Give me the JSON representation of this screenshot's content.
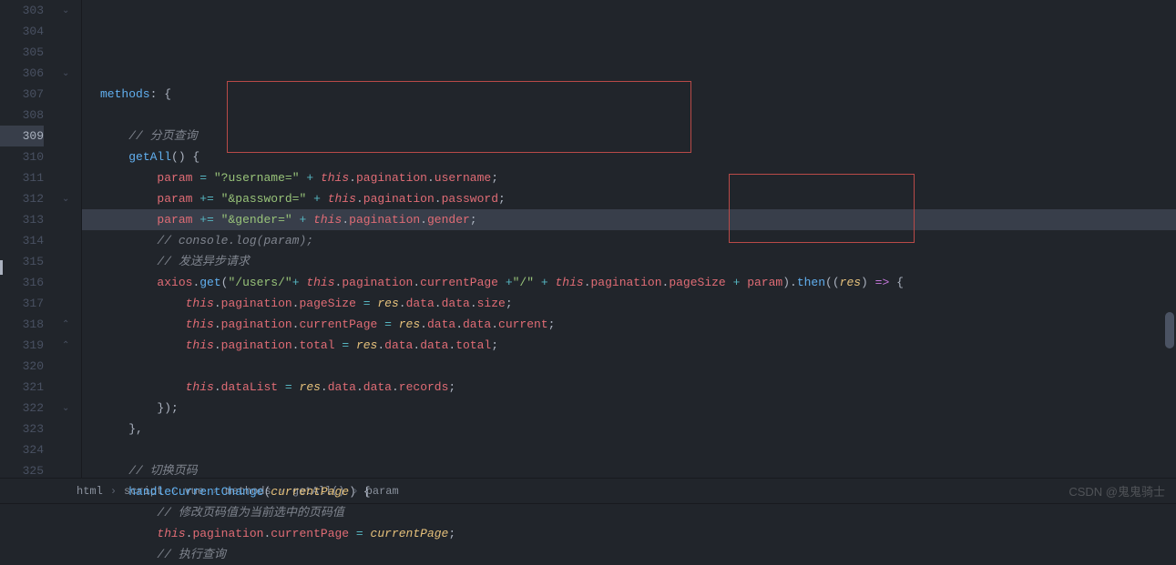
{
  "lines": [
    {
      "num": "303",
      "html": "<span class='c-method'>methods</span><span class='c-punct'>: {</span>"
    },
    {
      "num": "304",
      "html": ""
    },
    {
      "num": "305",
      "html": "    <span class='c-comment'>// 分页查询</span>"
    },
    {
      "num": "306",
      "html": "    <span class='c-method'>getAll</span><span class='c-punct'>() {</span>"
    },
    {
      "num": "307",
      "html": "        <span class='c-var'>param</span> <span class='c-op'>=</span> <span class='c-string'>\"?username=\"</span> <span class='c-op'>+</span> <span class='c-this'>this</span><span class='c-punct'>.</span><span class='c-prop'>pagination</span><span class='c-punct'>.</span><span class='c-prop'>username</span><span class='c-punct'>;</span>"
    },
    {
      "num": "308",
      "html": "        <span class='c-var'>param</span> <span class='c-op'>+=</span> <span class='c-string'>\"&amp;password=\"</span> <span class='c-op'>+</span> <span class='c-this'>this</span><span class='c-punct'>.</span><span class='c-prop'>pagination</span><span class='c-punct'>.</span><span class='c-prop'>password</span><span class='c-punct'>;</span>"
    },
    {
      "num": "309",
      "html": "        <span class='c-var'>param</span> <span class='c-op'>+=</span> <span class='c-string'>\"&amp;gender=\"</span> <span class='c-op'>+</span> <span class='c-this'>this</span><span class='c-punct'>.</span><span class='c-prop'>pagination</span><span class='c-punct'>.</span><span class='c-prop'>gender</span><span class='c-punct'>;</span>",
      "hl": true
    },
    {
      "num": "310",
      "html": "        <span class='c-comment'>// console.log(param);</span>"
    },
    {
      "num": "311",
      "html": "        <span class='c-comment'>// 发送异步请求</span>"
    },
    {
      "num": "312",
      "html": "        <span class='c-prop'>axios</span><span class='c-punct'>.</span><span class='c-method'>get</span><span class='c-punct'>(</span><span class='c-string'>\"/users/\"</span><span class='c-op'>+</span> <span class='c-this'>this</span><span class='c-punct'>.</span><span class='c-prop'>pagination</span><span class='c-punct'>.</span><span class='c-prop'>currentPage</span> <span class='c-op'>+</span><span class='c-string'>\"/\"</span> <span class='c-op'>+</span> <span class='c-this'>this</span><span class='c-punct'>.</span><span class='c-prop'>pagination</span><span class='c-punct'>.</span><span class='c-prop'>pageSize</span> <span class='c-op'>+</span> <span class='c-var'>param</span><span class='c-punct'>).</span><span class='c-method'>then</span><span class='c-punct'>((</span><span class='c-res'>res</span><span class='c-punct'>) </span><span class='c-arrow'>=&gt;</span><span class='c-punct'> {</span>"
    },
    {
      "num": "313",
      "html": "            <span class='c-this'>this</span><span class='c-punct'>.</span><span class='c-prop'>pagination</span><span class='c-punct'>.</span><span class='c-prop'>pageSize</span> <span class='c-op'>=</span> <span class='c-res'>res</span><span class='c-punct'>.</span><span class='c-prop'>data</span><span class='c-punct'>.</span><span class='c-prop'>data</span><span class='c-punct'>.</span><span class='c-prop'>size</span><span class='c-punct'>;</span>"
    },
    {
      "num": "314",
      "html": "            <span class='c-this'>this</span><span class='c-punct'>.</span><span class='c-prop'>pagination</span><span class='c-punct'>.</span><span class='c-prop'>currentPage</span> <span class='c-op'>=</span> <span class='c-res'>res</span><span class='c-punct'>.</span><span class='c-prop'>data</span><span class='c-punct'>.</span><span class='c-prop'>data</span><span class='c-punct'>.</span><span class='c-prop'>current</span><span class='c-punct'>;</span>"
    },
    {
      "num": "315",
      "html": "            <span class='c-this'>this</span><span class='c-punct'>.</span><span class='c-prop'>pagination</span><span class='c-punct'>.</span><span class='c-prop'>total</span> <span class='c-op'>=</span> <span class='c-res'>res</span><span class='c-punct'>.</span><span class='c-prop'>data</span><span class='c-punct'>.</span><span class='c-prop'>data</span><span class='c-punct'>.</span><span class='c-prop'>total</span><span class='c-punct'>;</span>"
    },
    {
      "num": "316",
      "html": ""
    },
    {
      "num": "317",
      "html": "            <span class='c-this'>this</span><span class='c-punct'>.</span><span class='c-prop'>dataList</span> <span class='c-op'>=</span> <span class='c-res'>res</span><span class='c-punct'>.</span><span class='c-prop'>data</span><span class='c-punct'>.</span><span class='c-prop'>data</span><span class='c-punct'>.</span><span class='c-prop'>records</span><span class='c-punct'>;</span>"
    },
    {
      "num": "318",
      "html": "        <span class='c-punct'>});</span>"
    },
    {
      "num": "319",
      "html": "    <span class='c-punct'>},</span>"
    },
    {
      "num": "320",
      "html": ""
    },
    {
      "num": "321",
      "html": "    <span class='c-comment'>// 切换页码</span>"
    },
    {
      "num": "322",
      "html": "    <span class='c-method'>handleCurrentChange</span><span class='c-punct'>(</span><span class='c-param'>currentPage</span><span class='c-punct'>) {</span>"
    },
    {
      "num": "323",
      "html": "        <span class='c-comment'>// 修改页码值为当前选中的页码值</span>"
    },
    {
      "num": "324",
      "html": "        <span class='c-this'>this</span><span class='c-punct'>.</span><span class='c-prop'>pagination</span><span class='c-punct'>.</span><span class='c-prop'>currentPage</span> <span class='c-op'>=</span> <span class='c-param'>currentPage</span><span class='c-punct'>;</span>"
    },
    {
      "num": "325",
      "html": "        <span class='c-comment'>// 执行查询</span>"
    }
  ],
  "breadcrumb": [
    "html",
    "script",
    "vue",
    "methods",
    "getAll()",
    "param"
  ],
  "watermark": "CSDN @鬼鬼骑士",
  "foldMarkers": [
    {
      "line": 303,
      "type": "open"
    },
    {
      "line": 306,
      "type": "open"
    },
    {
      "line": 312,
      "type": "open"
    },
    {
      "line": 318,
      "type": "close"
    },
    {
      "line": 319,
      "type": "close"
    },
    {
      "line": 322,
      "type": "open"
    }
  ]
}
